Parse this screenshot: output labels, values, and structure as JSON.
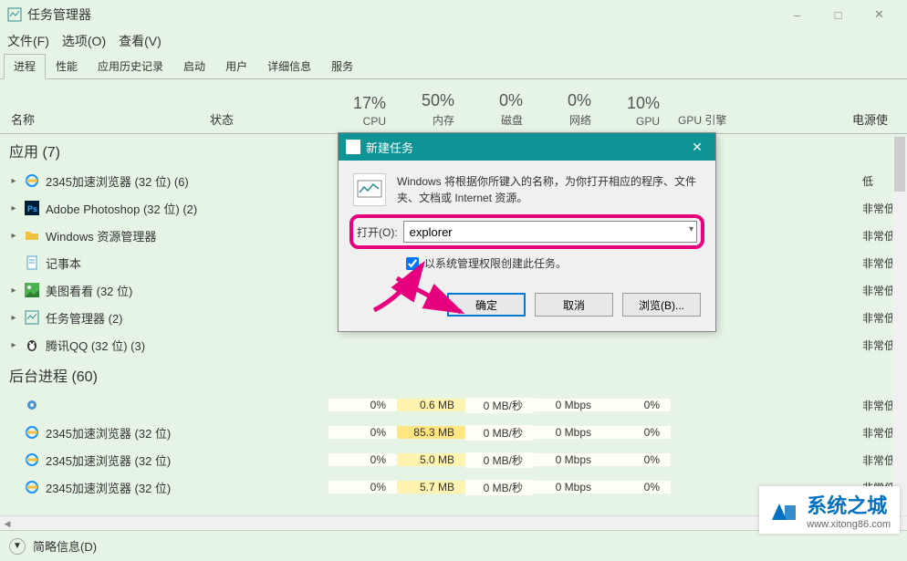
{
  "window": {
    "title": "任务管理器",
    "menus": {
      "file": "文件(F)",
      "options": "选项(O)",
      "view": "查看(V)"
    },
    "tabs": [
      "进程",
      "性能",
      "应用历史记录",
      "启动",
      "用户",
      "详细信息",
      "服务"
    ],
    "active_tab": 0,
    "headers": {
      "name": "名称",
      "status": "状态",
      "cols": [
        {
          "pct": "17%",
          "label": "CPU"
        },
        {
          "pct": "50%",
          "label": "内存"
        },
        {
          "pct": "0%",
          "label": "磁盘"
        },
        {
          "pct": "0%",
          "label": "网络"
        },
        {
          "pct": "10%",
          "label": "GPU"
        }
      ],
      "gpu_engine": "GPU 引擎",
      "power": "电源使"
    }
  },
  "groups": {
    "apps": {
      "title": "应用 (7)"
    },
    "bg": {
      "title": "后台进程 (60)"
    }
  },
  "apps": [
    {
      "name": "2345加速浏览器 (32 位) (6)",
      "icon": "ie",
      "power": "低"
    },
    {
      "name": "Adobe Photoshop (32 位) (2)",
      "icon": "ps",
      "power": "非常低"
    },
    {
      "name": "Windows 资源管理器",
      "icon": "folder",
      "power": "非常低"
    },
    {
      "name": "记事本",
      "icon": "note",
      "power": "非常低"
    },
    {
      "name": "美图看看 (32 位)",
      "icon": "img",
      "power": "非常低"
    },
    {
      "name": "任务管理器 (2)",
      "icon": "tm",
      "power": "非常低"
    },
    {
      "name": "腾讯QQ (32 位) (3)",
      "icon": "qq",
      "power": "非常低"
    }
  ],
  "bg": [
    {
      "name": "",
      "icon": "gear",
      "cpu": "0%",
      "mem": "0.6 MB",
      "disk": "0 MB/秒",
      "net": "0 Mbps",
      "gpu": "0%",
      "power": "非常低"
    },
    {
      "name": "2345加速浏览器 (32 位)",
      "icon": "ie",
      "cpu": "0%",
      "mem": "85.3 MB",
      "disk": "0 MB/秒",
      "net": "0 Mbps",
      "gpu": "0%",
      "power": "非常低"
    },
    {
      "name": "2345加速浏览器 (32 位)",
      "icon": "ie",
      "cpu": "0%",
      "mem": "5.0 MB",
      "disk": "0 MB/秒",
      "net": "0 Mbps",
      "gpu": "0%",
      "power": "非常低"
    },
    {
      "name": "2345加速浏览器 (32 位)",
      "icon": "ie",
      "cpu": "0%",
      "mem": "5.7 MB",
      "disk": "0 MB/秒",
      "net": "0 Mbps",
      "gpu": "0%",
      "power": "非常低"
    }
  ],
  "dialog": {
    "title": "新建任务",
    "message": "Windows 将根据你所键入的名称，为你打开相应的程序、文件夹、文档或 Internet 资源。",
    "open_label": "打开(O):",
    "open_value": "explorer",
    "admin_label": "以系统管理权限创建此任务。",
    "admin_checked": true,
    "buttons": {
      "ok": "确定",
      "cancel": "取消",
      "browse": "浏览(B)..."
    }
  },
  "footer": {
    "details": "简略信息(D)"
  },
  "watermark": {
    "brand": "系统之城",
    "url": "www.xitong86.com"
  }
}
